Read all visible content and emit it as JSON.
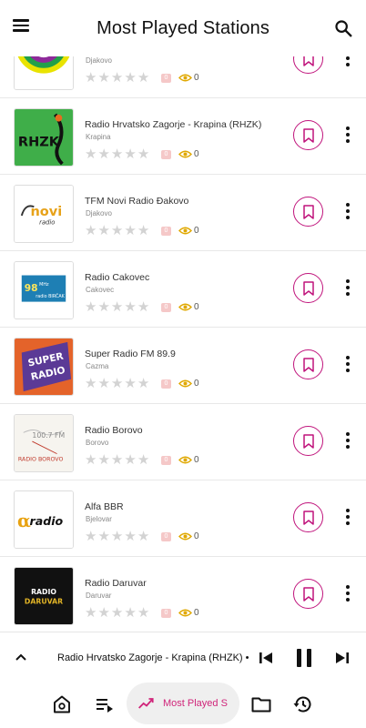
{
  "header": {
    "title": "Most Played Stations"
  },
  "stations": [
    {
      "name": "",
      "city": "Djakovo",
      "rating": 0,
      "badge": "0",
      "views": "0"
    },
    {
      "name": "Radio Hrvatsko Zagorje - Krapina (RHZK)",
      "city": "Krapina",
      "rating": 0,
      "badge": "0",
      "views": "0"
    },
    {
      "name": "TFM Novi Radio Đakovo",
      "city": "Djakovo",
      "rating": 0,
      "badge": "0",
      "views": "0"
    },
    {
      "name": "Radio Cakovec",
      "city": "Cakovec",
      "rating": 0,
      "badge": "0",
      "views": "0"
    },
    {
      "name": "Super Radio FM 89.9",
      "city": "Cazma",
      "rating": 0,
      "badge": "0",
      "views": "0"
    },
    {
      "name": "Radio Borovo",
      "city": "Borovo",
      "rating": 0,
      "badge": "0",
      "views": "0"
    },
    {
      "name": "Alfa BBR",
      "city": "Bjelovar",
      "rating": 0,
      "badge": "0",
      "views": "0"
    },
    {
      "name": "Radio Daruvar",
      "city": "Daruvar",
      "rating": 0,
      "badge": "0",
      "views": "0"
    }
  ],
  "logos": {
    "rhzk": "RHZK",
    "novi": "novi",
    "novi_sub": "radio",
    "cakovec_num": "98",
    "cakovec_mhz": "MHz",
    "cakovec_sub": "radio BIRČAK",
    "super_top": "SUPER",
    "super_bottom": "RADIO",
    "borovo_freq": "100.7 FM",
    "borovo_name": "RADIO BOROVO",
    "alfa": "radio",
    "daruvar_top": "RADIO",
    "daruvar_bottom": "DARUVAR"
  },
  "player": {
    "now_playing": "Radio Hrvatsko Zagorje - Krapina (RHZK) • K"
  },
  "bottom_nav": {
    "active_label": "Most Played S"
  },
  "colors": {
    "accent": "#c0147c",
    "nav_active_text": "#d0257a",
    "eye": "#e0a800"
  }
}
